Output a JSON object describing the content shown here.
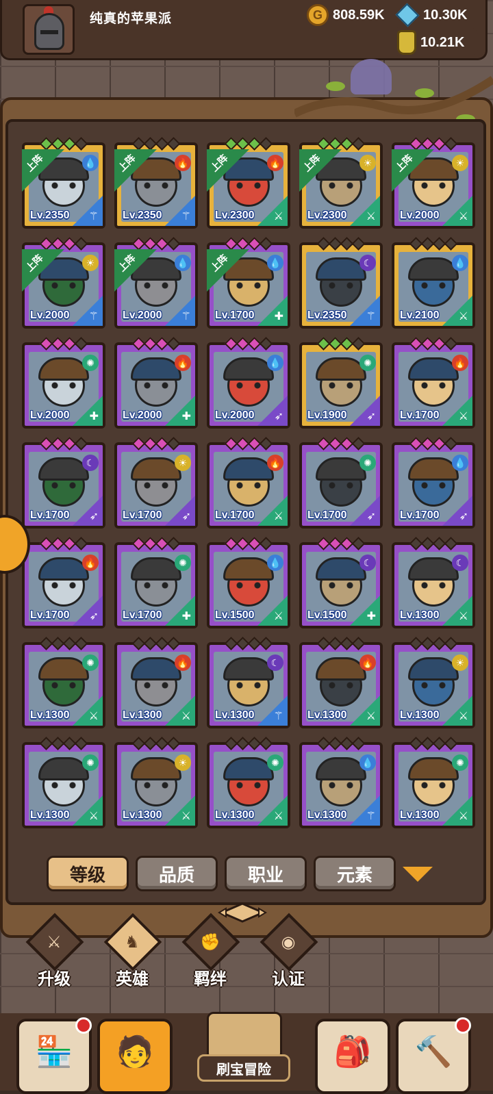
{
  "player": {
    "name": "纯真的苹果派"
  },
  "currencies": {
    "gold": "808.59K",
    "gems": "10.30K",
    "potion": "10.21K"
  },
  "heroes": [
    {
      "level": "Lv.2350",
      "frame": "gold",
      "deployed": true,
      "element": "water",
      "cls": "wand",
      "stars": "green"
    },
    {
      "level": "Lv.2350",
      "frame": "gold",
      "deployed": true,
      "element": "fire",
      "cls": "wand",
      "stars": "gray"
    },
    {
      "level": "Lv.2300",
      "frame": "gold",
      "deployed": true,
      "element": "fire",
      "cls": "sword",
      "stars": "green"
    },
    {
      "level": "Lv.2300",
      "frame": "gold",
      "deployed": true,
      "element": "light",
      "cls": "sword",
      "stars": "green"
    },
    {
      "level": "Lv.2000",
      "frame": "purple",
      "deployed": true,
      "element": "light",
      "cls": "sword",
      "stars": "pink"
    },
    {
      "level": "Lv.2000",
      "frame": "purple",
      "deployed": true,
      "element": "light",
      "cls": "wand",
      "stars": "pink"
    },
    {
      "level": "Lv.2000",
      "frame": "purple",
      "deployed": true,
      "element": "water",
      "cls": "wand",
      "stars": "pink"
    },
    {
      "level": "Lv.1700",
      "frame": "purple",
      "deployed": true,
      "element": "water",
      "cls": "shield",
      "stars": "pink"
    },
    {
      "level": "Lv.2350",
      "frame": "gold",
      "deployed": false,
      "element": "dark",
      "cls": "wand",
      "stars": "gray"
    },
    {
      "level": "Lv.2100",
      "frame": "gold",
      "deployed": false,
      "element": "water",
      "cls": "sword",
      "stars": "gray"
    },
    {
      "level": "Lv.2000",
      "frame": "purple",
      "deployed": false,
      "element": "wind",
      "cls": "shield",
      "stars": "pink"
    },
    {
      "level": "Lv.2000",
      "frame": "purple",
      "deployed": false,
      "element": "fire",
      "cls": "shield",
      "stars": "pink"
    },
    {
      "level": "Lv.2000",
      "frame": "purple",
      "deployed": false,
      "element": "water",
      "cls": "bow",
      "stars": "pink"
    },
    {
      "level": "Lv.1900",
      "frame": "gold",
      "deployed": false,
      "element": "wind",
      "cls": "bow",
      "stars": "green"
    },
    {
      "level": "Lv.1700",
      "frame": "purple",
      "deployed": false,
      "element": "fire",
      "cls": "sword",
      "stars": "pink"
    },
    {
      "level": "Lv.1700",
      "frame": "purple",
      "deployed": false,
      "element": "dark",
      "cls": "bow",
      "stars": "pink"
    },
    {
      "level": "Lv.1700",
      "frame": "purple",
      "deployed": false,
      "element": "light",
      "cls": "bow",
      "stars": "pink"
    },
    {
      "level": "Lv.1700",
      "frame": "purple",
      "deployed": false,
      "element": "fire",
      "cls": "sword",
      "stars": "pink"
    },
    {
      "level": "Lv.1700",
      "frame": "purple",
      "deployed": false,
      "element": "wind",
      "cls": "bow",
      "stars": "pink"
    },
    {
      "level": "Lv.1700",
      "frame": "purple",
      "deployed": false,
      "element": "water",
      "cls": "bow",
      "stars": "pink"
    },
    {
      "level": "Lv.1700",
      "frame": "purple",
      "deployed": false,
      "element": "fire",
      "cls": "bow",
      "stars": "pink"
    },
    {
      "level": "Lv.1700",
      "frame": "purple",
      "deployed": false,
      "element": "wind",
      "cls": "shield",
      "stars": "pink"
    },
    {
      "level": "Lv.1500",
      "frame": "purple",
      "deployed": false,
      "element": "water",
      "cls": "sword",
      "stars": "pink"
    },
    {
      "level": "Lv.1500",
      "frame": "purple",
      "deployed": false,
      "element": "dark",
      "cls": "shield",
      "stars": "pink"
    },
    {
      "level": "Lv.1300",
      "frame": "purple",
      "deployed": false,
      "element": "dark",
      "cls": "sword",
      "stars": "gray"
    },
    {
      "level": "Lv.1300",
      "frame": "purple",
      "deployed": false,
      "element": "wind",
      "cls": "sword",
      "stars": "gray"
    },
    {
      "level": "Lv.1300",
      "frame": "purple",
      "deployed": false,
      "element": "fire",
      "cls": "sword",
      "stars": "gray"
    },
    {
      "level": "Lv.1300",
      "frame": "purple",
      "deployed": false,
      "element": "dark",
      "cls": "wand",
      "stars": "gray"
    },
    {
      "level": "Lv.1300",
      "frame": "purple",
      "deployed": false,
      "element": "fire",
      "cls": "sword",
      "stars": "gray"
    },
    {
      "level": "Lv.1300",
      "frame": "purple",
      "deployed": false,
      "element": "light",
      "cls": "sword",
      "stars": "gray"
    },
    {
      "level": "Lv.1300",
      "frame": "purple",
      "deployed": false,
      "element": "wind",
      "cls": "sword",
      "stars": "gray"
    },
    {
      "level": "Lv.1300",
      "frame": "purple",
      "deployed": false,
      "element": "light",
      "cls": "sword",
      "stars": "gray"
    },
    {
      "level": "Lv.1300",
      "frame": "purple",
      "deployed": false,
      "element": "wind",
      "cls": "sword",
      "stars": "gray"
    },
    {
      "level": "Lv.1300",
      "frame": "purple",
      "deployed": false,
      "element": "water",
      "cls": "wand",
      "stars": "gray"
    },
    {
      "level": "Lv.1300",
      "frame": "purple",
      "deployed": false,
      "element": "wind",
      "cls": "sword",
      "stars": "gray"
    }
  ],
  "deployed_label": "上阵",
  "sort_tabs": [
    "等级",
    "品质",
    "职业",
    "元素"
  ],
  "bottom_tabs": [
    "升级",
    "英雄",
    "羁绊",
    "认证"
  ],
  "adventure_label": "刷宝冒险",
  "colors": {
    "water": "#3b7fd8",
    "fire": "#d8402a",
    "light": "#d8b22a",
    "dark": "#6a3ab8",
    "wind": "#2aa878"
  }
}
